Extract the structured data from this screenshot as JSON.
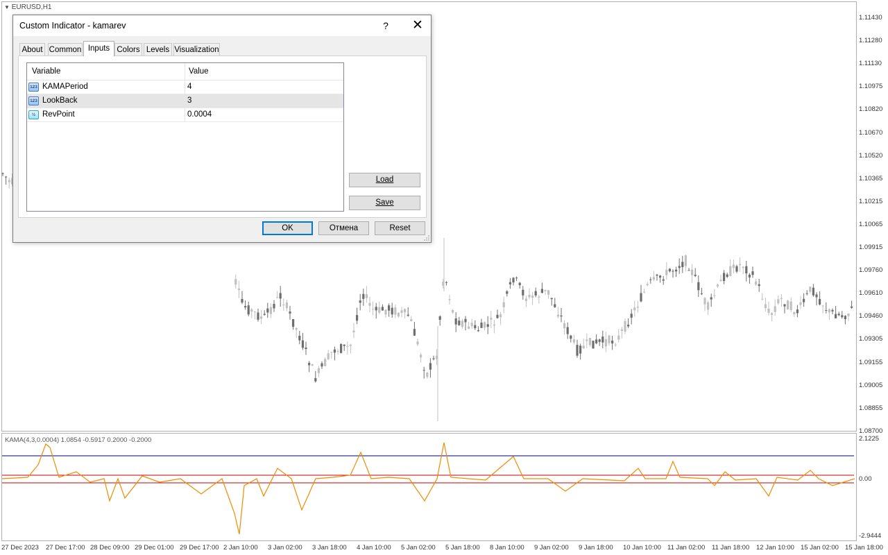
{
  "chart": {
    "symbol": "EURUSD,H1",
    "price_axis": [
      "1.11430",
      "1.11280",
      "1.11130",
      "1.10975",
      "1.10820",
      "1.10670",
      "1.10520",
      "1.10365",
      "1.10215",
      "1.10065",
      "1.09915",
      "1.09760",
      "1.09610",
      "1.09460",
      "1.09305",
      "1.09155",
      "1.09005",
      "1.08855",
      "1.08700"
    ],
    "time_axis": [
      "27 Dec 2023",
      "27 Dec 17:00",
      "28 Dec 09:00",
      "29 Dec 01:00",
      "29 Dec 17:00",
      "2 Jan 10:00",
      "3 Jan 02:00",
      "3 Jan 18:00",
      "4 Jan 10:00",
      "5 Jan 02:00",
      "5 Jan 18:00",
      "8 Jan 10:00",
      "9 Jan 02:00",
      "9 Jan 18:00",
      "10 Jan 10:00",
      "11 Jan 02:00",
      "11 Jan 18:00",
      "12 Jan 10:00",
      "15 Jan 02:00",
      "15 Jan 18:00"
    ],
    "colors": {
      "bull": "#c0c0c0",
      "bear": "#6e6e6e",
      "indicator": "#f08c00",
      "level_high": "#000080",
      "level": "#cc0000"
    }
  },
  "indicator": {
    "label": "KAMA(4,3,0.0004) 1.0854 -0.5917 0.2000 -0.2000",
    "scale_top": "2.1225",
    "scale_zero": "0.00",
    "scale_bottom": "-2.9444"
  },
  "dialog": {
    "title": "Custom Indicator - kamarev",
    "help": "?",
    "close": "✕",
    "tabs": [
      "About",
      "Common",
      "Inputs",
      "Colors",
      "Levels",
      "Visualization"
    ],
    "active_tab": "Inputs",
    "columns": {
      "variable": "Variable",
      "value": "Value"
    },
    "inputs": [
      {
        "icon": "123",
        "name": "KAMAPeriod",
        "value": "4"
      },
      {
        "icon": "123",
        "name": "LookBack",
        "value": "3"
      },
      {
        "icon": "½",
        "name": "RevPoint",
        "value": "0.0004"
      }
    ],
    "load_label": "Load",
    "save_label": "Save",
    "ok_label": "OK",
    "cancel_label": "Отмена",
    "reset_label": "Reset"
  }
}
